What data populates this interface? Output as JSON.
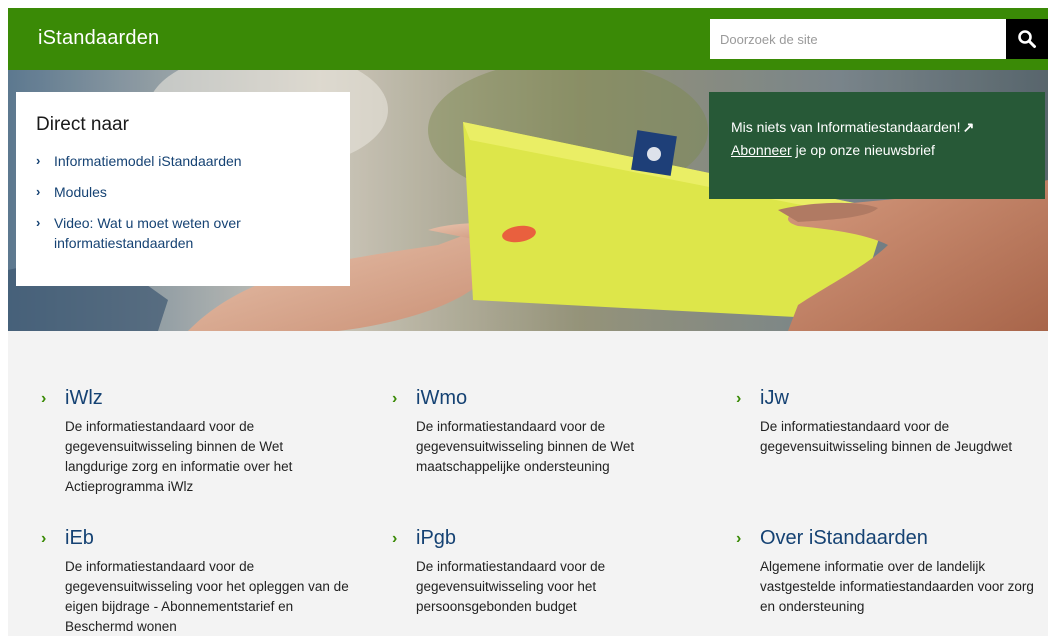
{
  "header": {
    "brand": "iStandaarden",
    "search_placeholder": "Doorzoek de site",
    "search_icon": "search-icon"
  },
  "direct_naar": {
    "title": "Direct naar",
    "links": [
      "Informatiemodel iStandaarden",
      "Modules",
      "Video: Wat u moet weten over informatiestandaarden"
    ]
  },
  "newsletter": {
    "line1": "Mis niets van Informatiestandaarden!",
    "external_icon": "external-link-icon",
    "link": "Abonneer",
    "rest": " je op onze nieuwsbrief"
  },
  "colors": {
    "header_green": "#3a8a06",
    "newsletter_green": "#275937",
    "link_blue": "#154273",
    "chevron_green": "#3a8a06"
  },
  "cards": [
    {
      "title": "iWlz",
      "desc": "De informatiestandaard voor de gegevensuitwisseling binnen de Wet langdurige zorg en informatie over het Actieprogramma iWlz"
    },
    {
      "title": "iWmo",
      "desc": "De informatiestandaard voor de gegevensuitwisseling binnen de Wet maatschappelijke ondersteuning"
    },
    {
      "title": "iJw",
      "desc": "De informatiestandaard voor de gegevensuitwisseling binnen de Jeugdwet"
    },
    {
      "title": "iEb",
      "desc": "De informatiestandaard voor de gegevensuitwisseling voor het opleggen van de eigen bijdrage - Abonnementstarief en Beschermd wonen"
    },
    {
      "title": "iPgb",
      "desc": "De informatiestandaard voor de gegevensuitwisseling voor het persoonsgebonden budget"
    },
    {
      "title": "Over iStandaarden",
      "desc": "Algemene informatie over de landelijk vastgestelde informatiestandaarden voor zorg en ondersteuning"
    }
  ]
}
